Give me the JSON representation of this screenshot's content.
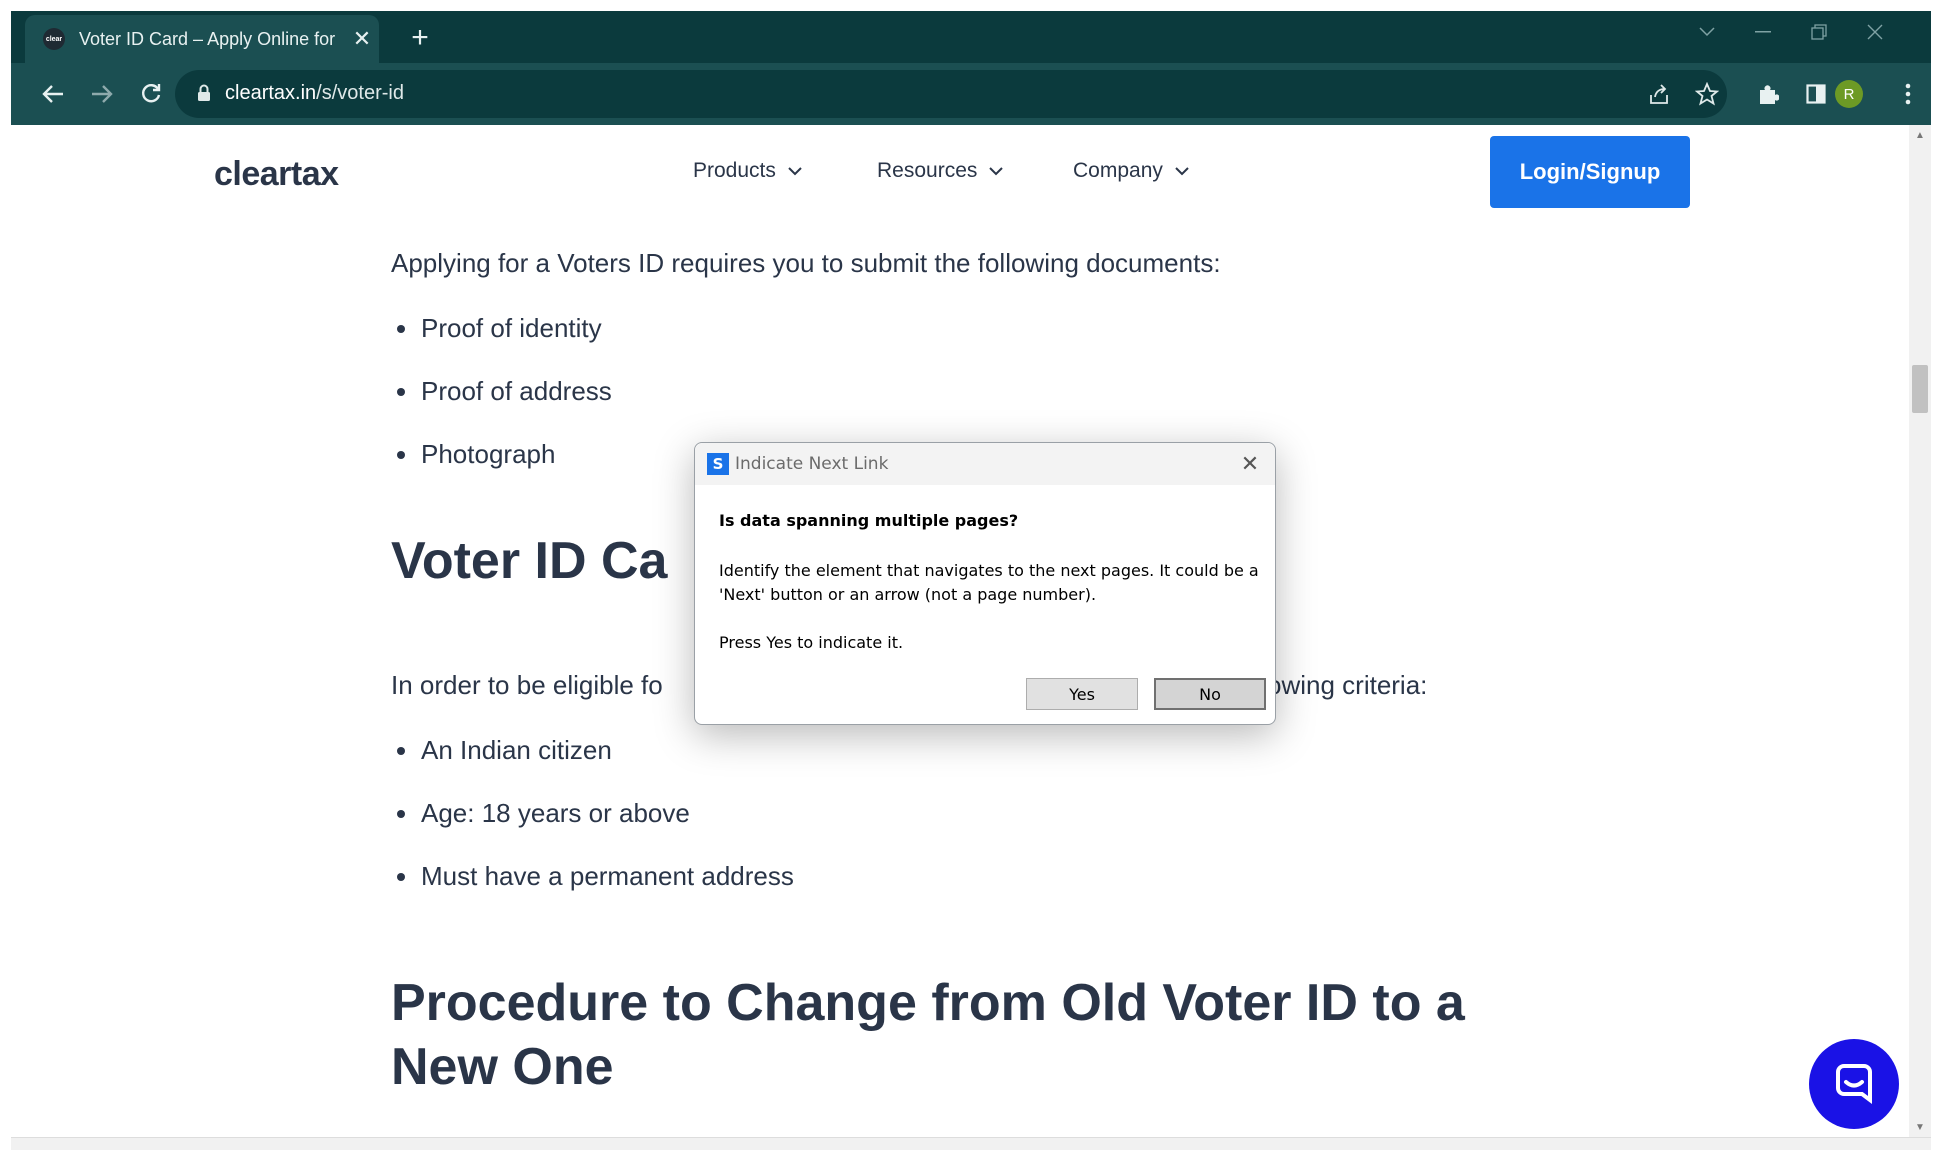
{
  "browser": {
    "tab_title": "Voter ID Card – Apply Online for",
    "favicon_text": "clear",
    "tab_close": "✕",
    "new_tab": "+",
    "url_domain": "cleartax.in",
    "url_path": "/s/voter-id",
    "avatar_letter": "R",
    "colors": {
      "tabstrip": "#0b3a3d",
      "toolbar": "#1b4f52",
      "avatar": "#6d9a25"
    }
  },
  "site": {
    "logo": "cleartax",
    "nav": [
      "Products",
      "Resources",
      "Company"
    ],
    "login_label": "Login/Signup",
    "accent": "#1a73e8"
  },
  "content": {
    "intro": "Applying for a Voters ID requires you to submit the following documents:",
    "documents": [
      "Proof of identity",
      "Proof of address",
      "Photograph"
    ],
    "eligibility_heading": "Voter ID Ca",
    "eligibility_intro_left": "In order to be eligible fo",
    "eligibility_intro_right": "owing criteria:",
    "criteria": [
      "An Indian citizen",
      "Age: 18 years or above",
      "Must have a permanent address"
    ],
    "procedure_heading_line1": "Procedure to Change from Old Voter ID to a",
    "procedure_heading_line2": "New One"
  },
  "dialog": {
    "icon_glyph": "S",
    "title": "Indicate Next Link",
    "question": "Is data spanning multiple pages?",
    "body": "Identify the element that navigates to the next pages. It could be a 'Next' button or an arrow (not a page number).",
    "press": "Press Yes to indicate it.",
    "yes_label": "Yes",
    "no_label": "No",
    "close": "✕"
  }
}
